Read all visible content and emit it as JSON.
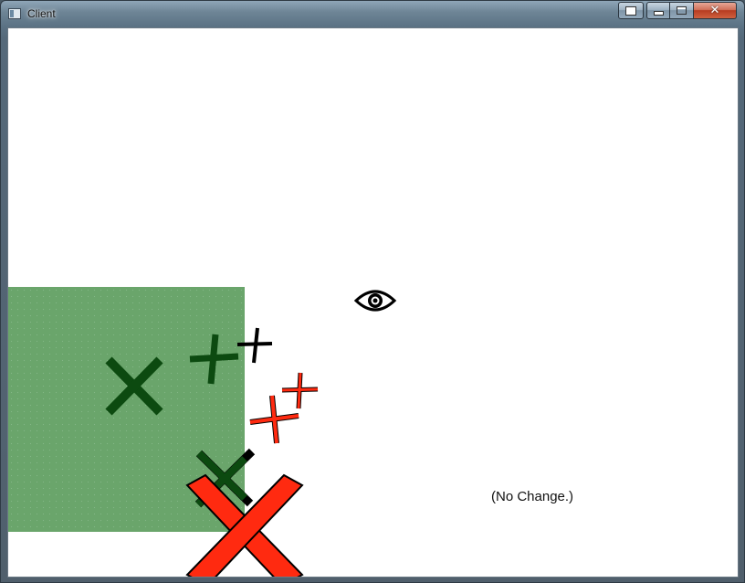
{
  "window": {
    "title": "Client",
    "controls": [
      "extra-button",
      "minimize-button",
      "maximize-button",
      "close-button"
    ]
  },
  "scene": {
    "status_text": "(No Change.)",
    "colors": {
      "background": "#ffffff",
      "green_area": "#6aa56b",
      "dark_green": "#0c4a10",
      "black": "#000000",
      "red": "#ff2a10"
    },
    "icons": [
      "eye-icon"
    ]
  }
}
